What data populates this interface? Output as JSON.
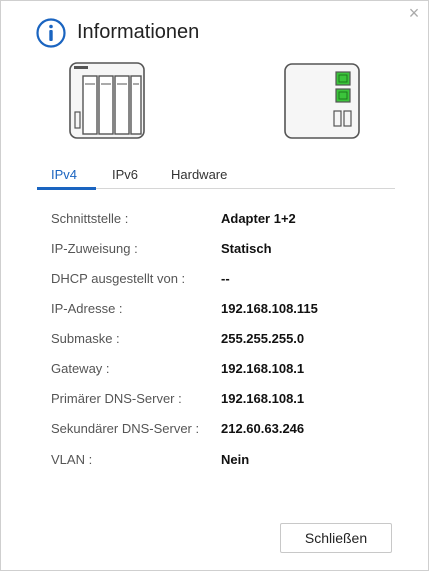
{
  "dialog": {
    "title": "Informationen",
    "close_symbol": "×",
    "close_button_label": "",
    "icon_name": "info-icon"
  },
  "devices": [
    {
      "name": "nas-front-view",
      "description": ""
    },
    {
      "name": "nas-rear-view",
      "description": ""
    }
  ],
  "tabs": [
    {
      "label": "IPv4",
      "active": true
    },
    {
      "label": "IPv6",
      "active": false
    },
    {
      "label": "Hardware",
      "active": false
    }
  ],
  "info": {
    "rows": [
      {
        "label": "Schnittstelle :",
        "value": "Adapter 1+2"
      },
      {
        "label": "IP-Zuweisung :",
        "value": "Statisch"
      },
      {
        "label": "DHCP ausgestellt von :",
        "value": "--"
      },
      {
        "label": "IP-Adresse :",
        "value": "192.168.108.115"
      },
      {
        "label": "Submaske :",
        "value": "255.255.255.0"
      },
      {
        "label": "Gateway :",
        "value": "192.168.108.1"
      },
      {
        "label": "Primärer DNS-Server :",
        "value": "192.168.108.1"
      },
      {
        "label": "Sekundärer DNS-Server :",
        "value": "212.60.63.246"
      },
      {
        "label": "VLAN :",
        "value": "Nein"
      }
    ]
  },
  "footer": {
    "close_label": "Schließen"
  },
  "colors": {
    "accent": "#1a64c0",
    "port_green": "#3bc43b"
  }
}
